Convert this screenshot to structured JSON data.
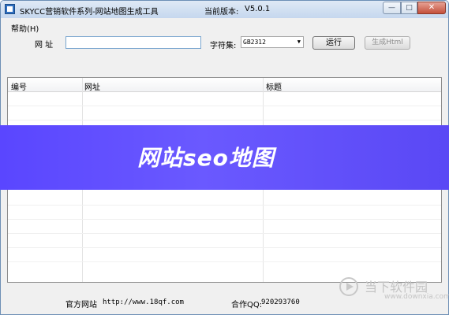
{
  "window": {
    "title": "SKYCC营销软件系列-网站地图生成工具",
    "version_label": "当前版本:",
    "version_value": "V5.0.1",
    "controls": {
      "minimize": "—",
      "maximize": "□",
      "close": "✕"
    }
  },
  "menu": {
    "help": "帮助(H)"
  },
  "form": {
    "url_label": "网 址",
    "url_value": "",
    "charset_label": "字符集:",
    "charset_value": "GB2312",
    "run_button": "运行",
    "generate_button": "生成Html"
  },
  "table": {
    "columns": [
      "编号",
      "网址",
      "标题"
    ],
    "rows": []
  },
  "overlay": {
    "banner_text": "网站seo地图"
  },
  "footer": {
    "site_label": "官方网站",
    "site_url": "http://www.18qf.com",
    "qq_label": "合作QQ:",
    "qq_value": "920293760"
  },
  "watermark": {
    "cn": "当下软件园",
    "en": "www.downxia.com"
  },
  "colors": {
    "banner": "#6a59ff",
    "title_bar": "#c5d7ee",
    "close_button": "#c4503b"
  }
}
